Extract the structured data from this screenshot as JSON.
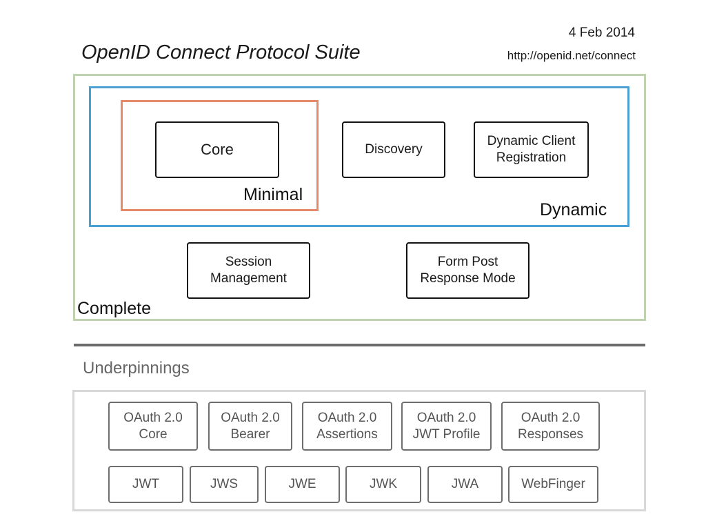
{
  "header": {
    "title": "OpenID Connect Protocol Suite",
    "date": "4 Feb 2014",
    "url": "http://openid.net/connect"
  },
  "colors": {
    "complete_border": "#bfd2b0",
    "dynamic_border": "#4a9fd3",
    "minimal_border": "#e48a68",
    "spec_border": "#111111",
    "underpinning_border": "#6e6e6e",
    "divider": "#6b6b6b"
  },
  "groups": {
    "minimal": {
      "label": "Minimal"
    },
    "dynamic": {
      "label": "Dynamic"
    },
    "complete": {
      "label": "Complete"
    }
  },
  "specs": {
    "core": "Core",
    "discovery": "Discovery",
    "dynamic_client_registration": "Dynamic Client\nRegistration",
    "session_management": "Session\nManagement",
    "form_post_response_mode": "Form Post\nResponse Mode"
  },
  "underpinnings": {
    "label": "Underpinnings",
    "row1": [
      "OAuth 2.0\nCore",
      "OAuth 2.0\nBearer",
      "OAuth 2.0\nAssertions",
      "OAuth 2.0\nJWT Profile",
      "OAuth 2.0\nResponses"
    ],
    "row2": [
      "JWT",
      "JWS",
      "JWE",
      "JWK",
      "JWA",
      "WebFinger"
    ]
  }
}
